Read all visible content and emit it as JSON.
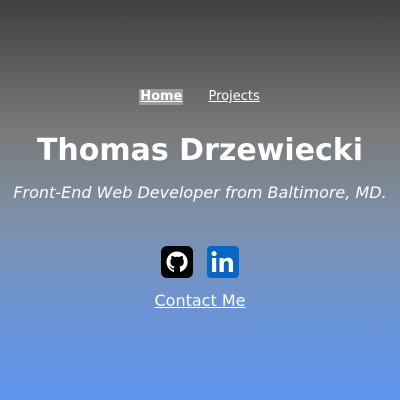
{
  "nav": {
    "items": [
      {
        "label": "Home",
        "active": true
      },
      {
        "label": "Projects",
        "active": false
      }
    ]
  },
  "hero": {
    "name": "Thomas Drzewiecki",
    "tagline": "Front-End Web Developer from Baltimore, MD."
  },
  "social": {
    "icons": [
      "github-icon",
      "linkedin-icon"
    ]
  },
  "contact": {
    "label": "Contact Me"
  },
  "colors": {
    "gradient_top": "#3f3f3f",
    "gradient_bottom": "#5f93ee",
    "text": "#ffffff",
    "linkedin": "#0a66c2",
    "github": "#000000"
  }
}
